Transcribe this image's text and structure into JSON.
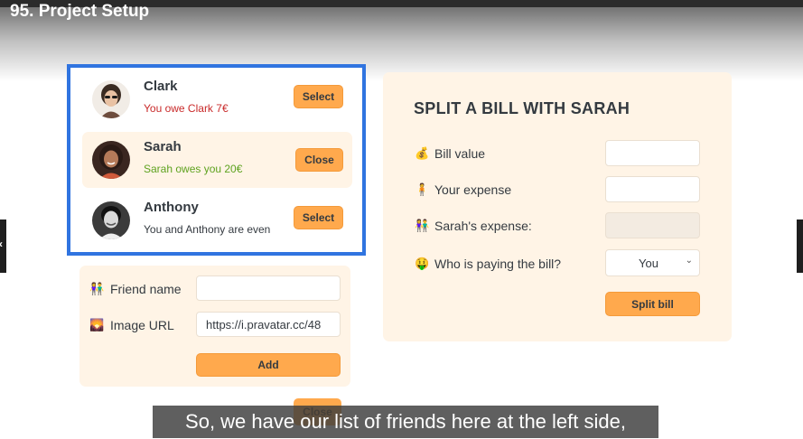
{
  "video": {
    "title": "95. Project Setup"
  },
  "friends": [
    {
      "name": "Clark",
      "status": "You owe Clark 7€",
      "button": "Select"
    },
    {
      "name": "Sarah",
      "status": "Sarah owes you 20€",
      "button": "Close"
    },
    {
      "name": "Anthony",
      "status": "You and Anthony are even",
      "button": "Select"
    }
  ],
  "add_form": {
    "friend_name": {
      "icon": "👫",
      "label": "Friend name",
      "value": ""
    },
    "image_url": {
      "icon": "🌄",
      "label": "Image URL",
      "value": "https://i.pravatar.cc/48"
    },
    "add_button": "Add"
  },
  "close_button": "Close",
  "split_form": {
    "title": "SPLIT A BILL WITH SARAH",
    "bill_value": {
      "icon": "💰",
      "label": "Bill value",
      "value": ""
    },
    "your_expense": {
      "icon": "🧍",
      "label": "Your expense",
      "value": ""
    },
    "friend_expense": {
      "icon": "👫",
      "label": "Sarah's expense:",
      "value": ""
    },
    "payer": {
      "icon": "🤑",
      "label": "Who is paying the bill?",
      "value": "You"
    },
    "split_button": "Split bill"
  },
  "caption": "So, we have our list of friends here at the left side,",
  "colors": {
    "accent": "#ffa94d",
    "panel": "#fff4e6",
    "highlight": "#3074e0",
    "owe": "#c92a2a",
    "owed": "#5ea21f"
  }
}
